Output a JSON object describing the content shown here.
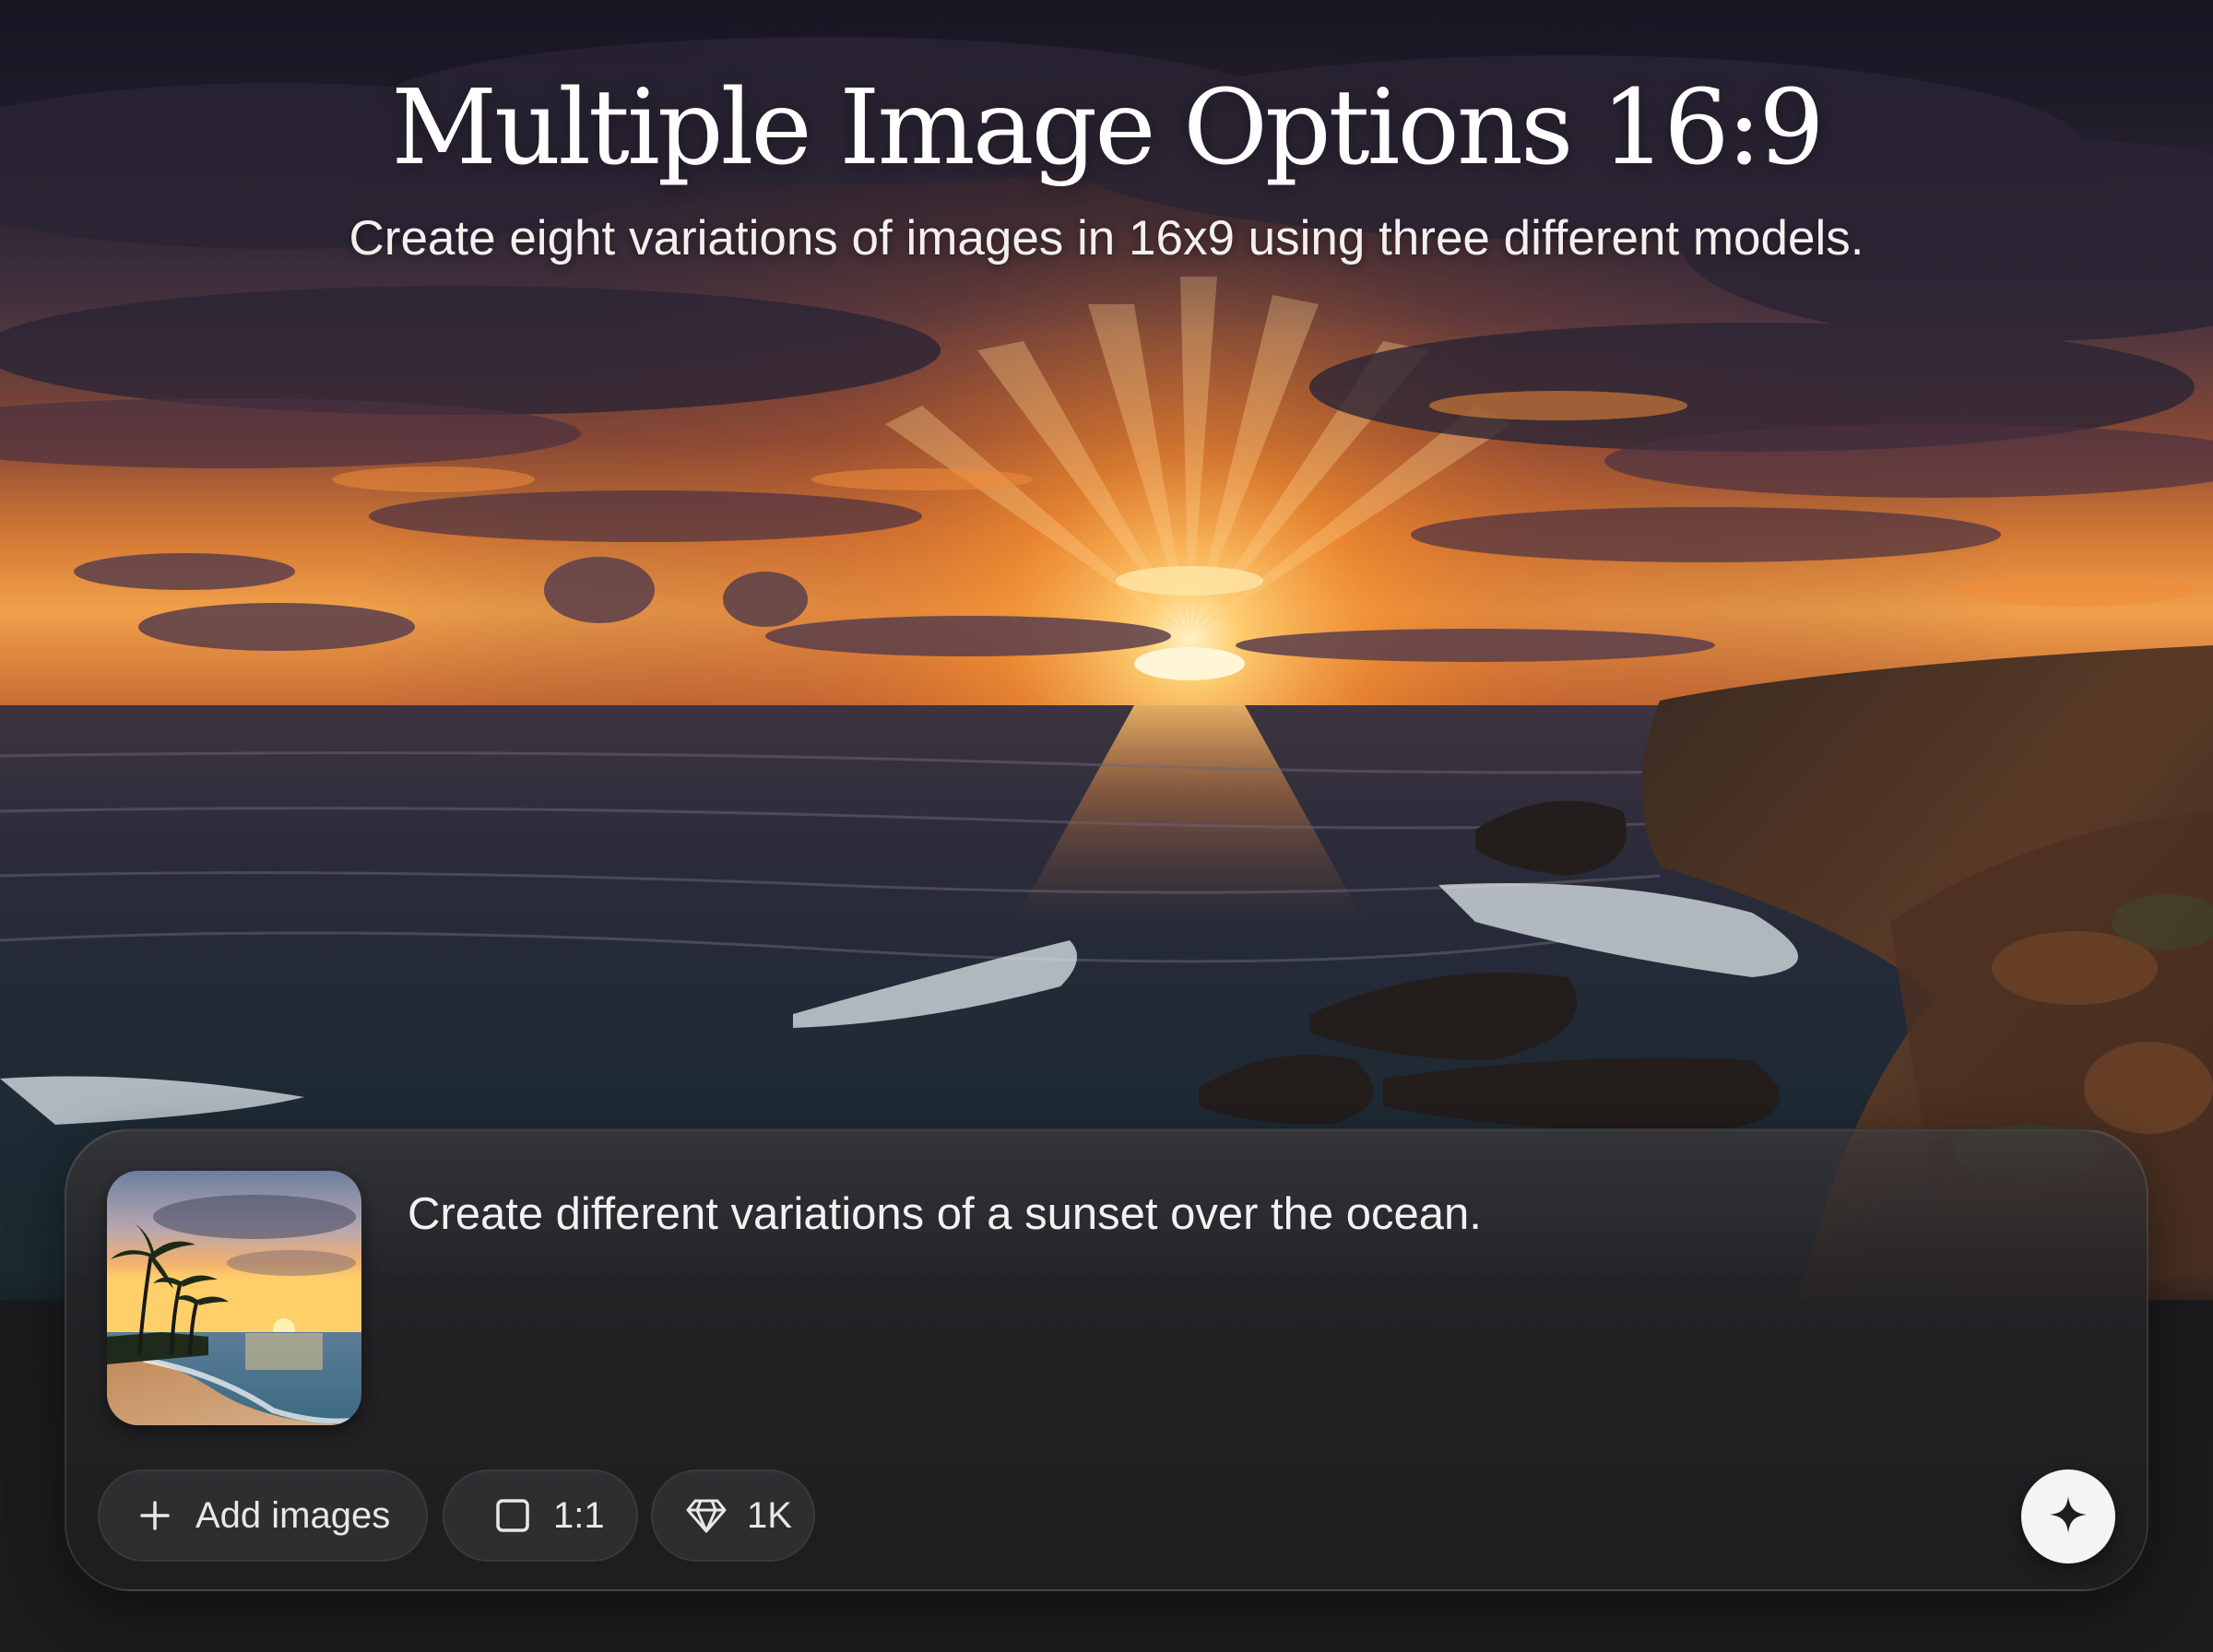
{
  "header": {
    "title": "Multiple Image Options 16:9",
    "subtitle": "Create eight variations of images in 16x9 using three different models."
  },
  "composer": {
    "prompt_text": "Create different variations of a sunset over the ocean.",
    "attachment_icon": "image-thumbnail",
    "toolbar": {
      "add_images_label": "Add images",
      "add_images_icon": "plus-icon",
      "aspect_ratio_label": "1:1",
      "aspect_ratio_icon": "square-icon",
      "resolution_label": "1K",
      "resolution_icon": "diamond-icon"
    },
    "submit_icon": "sparkle-icon"
  },
  "colors": {
    "background": "#1b1b1d",
    "accent_sun": "#ffb347",
    "submit_button": "#f4f4f4"
  }
}
